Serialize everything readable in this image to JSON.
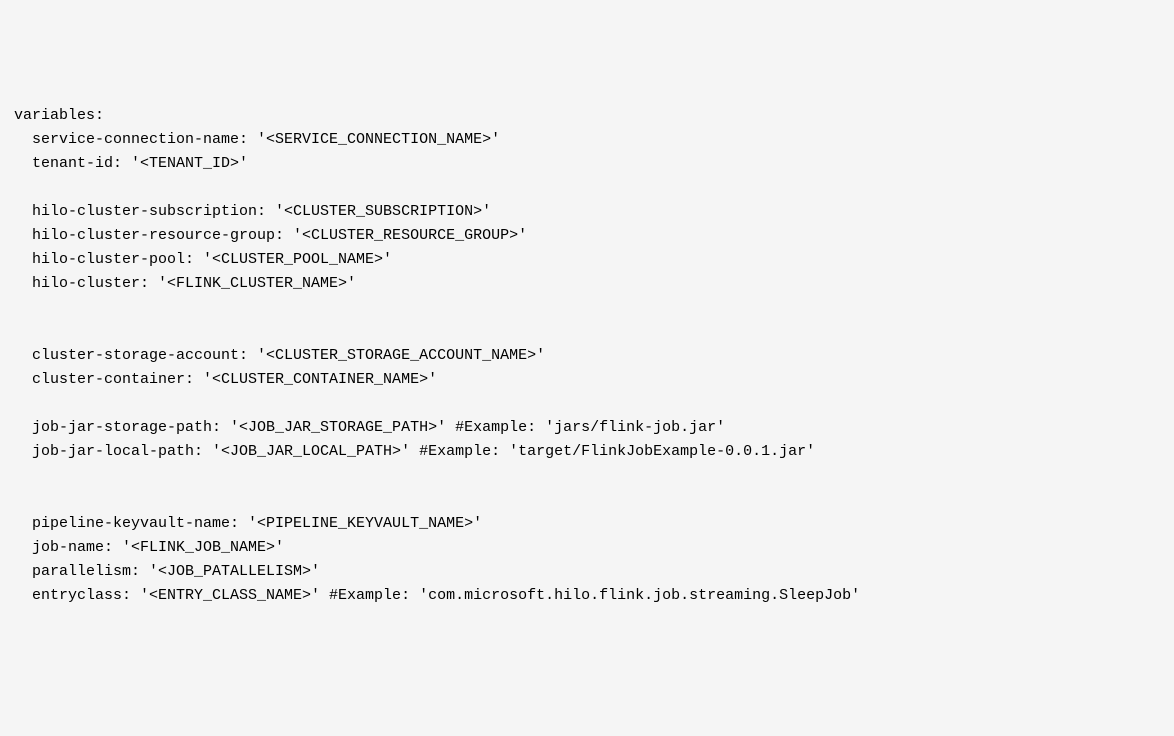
{
  "code": {
    "header": "variables:",
    "lines": [
      {
        "key": "service-connection-name",
        "value": "'<SERVICE_CONNECTION_NAME>'",
        "comment": ""
      },
      {
        "key": "tenant-id",
        "value": "'<TENANT_ID>'",
        "comment": ""
      },
      {
        "blank": true
      },
      {
        "key": "hilo-cluster-subscription",
        "value": "'<CLUSTER_SUBSCRIPTION>'",
        "comment": ""
      },
      {
        "key": "hilo-cluster-resource-group",
        "value": "'<CLUSTER_RESOURCE_GROUP>'",
        "comment": ""
      },
      {
        "key": "hilo-cluster-pool",
        "value": "'<CLUSTER_POOL_NAME>'",
        "comment": ""
      },
      {
        "key": "hilo-cluster",
        "value": "'<FLINK_CLUSTER_NAME>'",
        "comment": ""
      },
      {
        "blank": true
      },
      {
        "blank": true
      },
      {
        "key": "cluster-storage-account",
        "value": "'<CLUSTER_STORAGE_ACCOUNT_NAME>'",
        "comment": ""
      },
      {
        "key": "cluster-container",
        "value": "'<CLUSTER_CONTAINER_NAME>'",
        "comment": ""
      },
      {
        "blank": true
      },
      {
        "key": "job-jar-storage-path",
        "value": "'<JOB_JAR_STORAGE_PATH>'",
        "comment": " #Example: 'jars/flink-job.jar'"
      },
      {
        "key": "job-jar-local-path",
        "value": "'<JOB_JAR_LOCAL_PATH>'",
        "comment": " #Example: 'target/FlinkJobExample-0.0.1.jar'"
      },
      {
        "blank": true
      },
      {
        "blank": true
      },
      {
        "key": "pipeline-keyvault-name",
        "value": "'<PIPELINE_KEYVAULT_NAME>'",
        "comment": ""
      },
      {
        "key": "job-name",
        "value": "'<FLINK_JOB_NAME>'",
        "comment": ""
      },
      {
        "key": "parallelism",
        "value": "'<JOB_PATALLELISM>'",
        "comment": ""
      },
      {
        "key": "entryclass",
        "value": "'<ENTRY_CLASS_NAME>'",
        "comment": " #Example: 'com.microsoft.hilo.flink.job.streaming.SleepJob'"
      }
    ]
  }
}
